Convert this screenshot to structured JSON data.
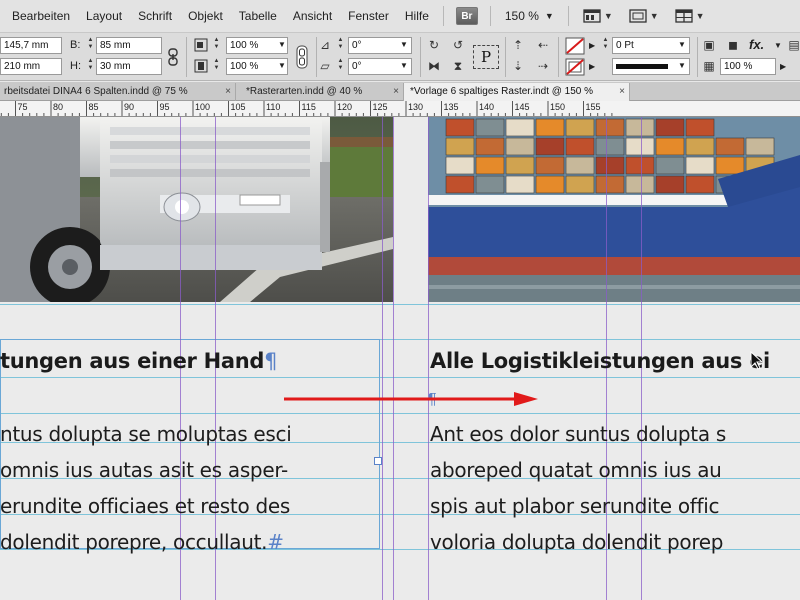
{
  "menu": [
    "Bearbeiten",
    "Layout",
    "Schrift",
    "Objekt",
    "Tabelle",
    "Ansicht",
    "Fenster",
    "Hilfe"
  ],
  "bridge_button": "Br",
  "zoom": "150 %",
  "control": {
    "x_value": "145,7 mm",
    "y_value": "210 mm",
    "w_label": "B:",
    "w_value": "85 mm",
    "h_label": "H:",
    "h_value": "30 mm",
    "scale_x": "100 %",
    "scale_y": "100 %",
    "rotate": "0°",
    "shear": "0°",
    "stroke_weight": "0 Pt",
    "opacity": "100 %",
    "fx_label": "fx.",
    "text_frame_glyph": "P"
  },
  "tabs": [
    {
      "label": "rbeitsdatei DINA4 6 Spalten.indd @ 75 %",
      "close": "×"
    },
    {
      "label": "*Rasterarten.indd @ 40 %",
      "close": "×"
    },
    {
      "label": "*Vorlage 6 spaltiges Raster.indt @ 150 %",
      "close": "×"
    }
  ],
  "ruler_ticks": [
    "70",
    "75",
    "80",
    "85",
    "90",
    "95",
    "100",
    "105",
    "110",
    "115",
    "120",
    "125",
    "130",
    "135",
    "140",
    "145",
    "150",
    "155"
  ],
  "left_column": {
    "headline": "tungen aus einer Hand",
    "lines": [
      "ntus dolupta se moluptas esci",
      " omnis ius autas asit es asper-",
      "erundite officiaes et resto des",
      "dolendit porepre, occullaut."
    ],
    "end_mark": "#"
  },
  "right_column": {
    "headline": "Alle Logistikleistungen aus ei",
    "lines": [
      "Ant eos dolor suntus dolupta s",
      "aboreped quatat omnis ius au",
      "spis aut plabor serundite offic",
      "voloria dolupta dolendit porep"
    ]
  },
  "pilcrow": "¶",
  "colors": {
    "accent_red": "#e11a1a",
    "column_guide": "#8a5cc8",
    "baseline_grid": "#73c0d8",
    "frame_edge": "#6aa7d6"
  },
  "icons": [
    "layout-dropdown-icon",
    "screen-mode-icon",
    "arrange-documents-icon",
    "reference-point-icon",
    "constrain-link-icon",
    "rotate-icon",
    "flip-icon",
    "fill-swatch-icon",
    "stroke-swatch-icon",
    "drop-shadow-icon",
    "effects-icon",
    "select-cursor-icon",
    "red-arrow"
  ]
}
